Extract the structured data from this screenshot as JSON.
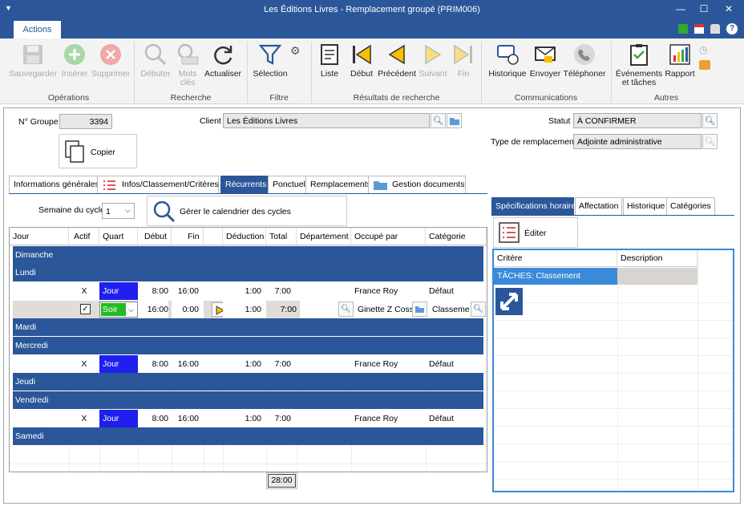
{
  "window": {
    "title": "Les Éditions Livres - Remplacement groupé (PRIM006)"
  },
  "ribbon_tab": "Actions",
  "ribbon": {
    "save": "Sauvegarder",
    "insert": "Insérer",
    "delete": "Supprimer",
    "group_operations": "Opérations",
    "start": "Débuter",
    "keywords": "Mots clés",
    "refresh": "Actualiser",
    "group_search": "Recherche",
    "selection": "Sélection",
    "group_filter": "Filtre",
    "list": "Liste",
    "first": "Début",
    "previous": "Précédent",
    "next": "Suivant",
    "last": "Fin",
    "group_results": "Résultats de recherche",
    "history": "Historique",
    "send": "Envoyer",
    "phone": "Téléphoner",
    "group_comms": "Communications",
    "events": "Événements et tâches",
    "report": "Rapport",
    "group_others": "Autres"
  },
  "form": {
    "group_label": "N° Groupe",
    "group_value": "3394",
    "client_label": "Client",
    "client_value": "Les Éditions Livres",
    "status_label": "Statut",
    "status_value": "À CONFIRMER",
    "type_label": "Type de remplacement",
    "type_value": "Adjointe administrative",
    "copy_button": "Copier"
  },
  "tabs": [
    "Informations générales",
    "Infos/Classement/Critères",
    "Récurrents",
    "Ponctuel",
    "Remplacements",
    "Gestion documents"
  ],
  "cycle": {
    "label": "Semaine du cycle",
    "value": "1",
    "manage": "Gérer le calendrier des cycles"
  },
  "grid": {
    "headers": [
      "Jour",
      "Actif",
      "Quart",
      "Début",
      "Fin",
      "Déduction",
      "Total",
      "Département",
      "Occupé par",
      "Catégorie"
    ],
    "days": {
      "sun": "Dimanche",
      "mon": "Lundi",
      "tue": "Mardi",
      "wed": "Mercredi",
      "thu": "Jeudi",
      "fri": "Vendredi",
      "sat": "Samedi"
    },
    "rows": [
      {
        "actif": "X",
        "quart": "Jour",
        "debut": "8:00",
        "fin": "16:00",
        "deduction": "1:00",
        "total": "7:00",
        "occupe": "France Roy",
        "categorie": "Défaut"
      },
      {
        "quart": "Soir",
        "debut": "16:00",
        "fin": "0:00",
        "deduction": "1:00",
        "total": "7:00",
        "occupe": "Ginette Z Cossi",
        "categorie": "Classement"
      },
      {
        "actif": "X",
        "quart": "Jour",
        "debut": "8:00",
        "fin": "16:00",
        "deduction": "1:00",
        "total": "7:00",
        "occupe": "France Roy",
        "categorie": "Défaut"
      },
      {
        "actif": "X",
        "quart": "Jour",
        "debut": "8:00",
        "fin": "16:00",
        "deduction": "1:00",
        "total": "7:00",
        "occupe": "France Roy",
        "categorie": "Défaut"
      }
    ],
    "total": "28:00"
  },
  "right_tabs": [
    "Spécifications horaire",
    "Affectation",
    "Historique",
    "Catégories"
  ],
  "edit_button": "Éditer",
  "criteria": {
    "headers": [
      "Critère",
      "Description"
    ],
    "row": "TÂCHES: Classement"
  },
  "colors": {
    "accent": "#2b579a",
    "selection": "#3a8ad8",
    "evening": "#22bb22"
  }
}
